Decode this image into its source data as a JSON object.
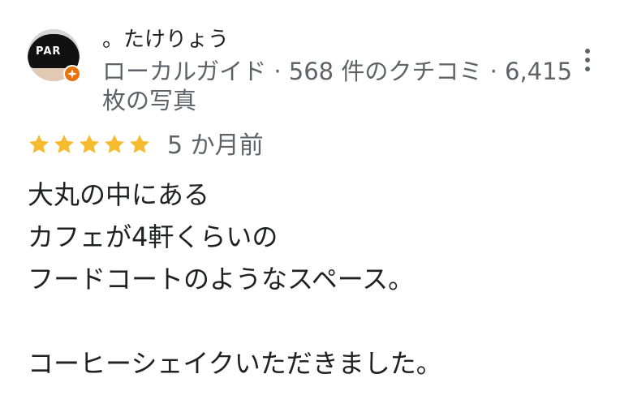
{
  "reviewer": {
    "name": "。たけりょう",
    "meta": "ローカルガイド · 568 件のクチコミ · 6,415 枚の写真",
    "avatar_text": "PAR"
  },
  "review": {
    "rating": 5,
    "time": "5 か月前",
    "lines": [
      "大丸の中にある",
      "カフェが4軒くらいの",
      "フードコートのようなスペース。",
      "",
      "コーヒーシェイクいただきました。"
    ]
  },
  "colors": {
    "star": "#f6bb2e",
    "badge": "#e8710a",
    "meta_text": "#5f6368",
    "text": "#202124"
  },
  "icons": {
    "more": "more-vert-icon",
    "star": "star-icon",
    "badge": "local-guide-badge-icon"
  }
}
